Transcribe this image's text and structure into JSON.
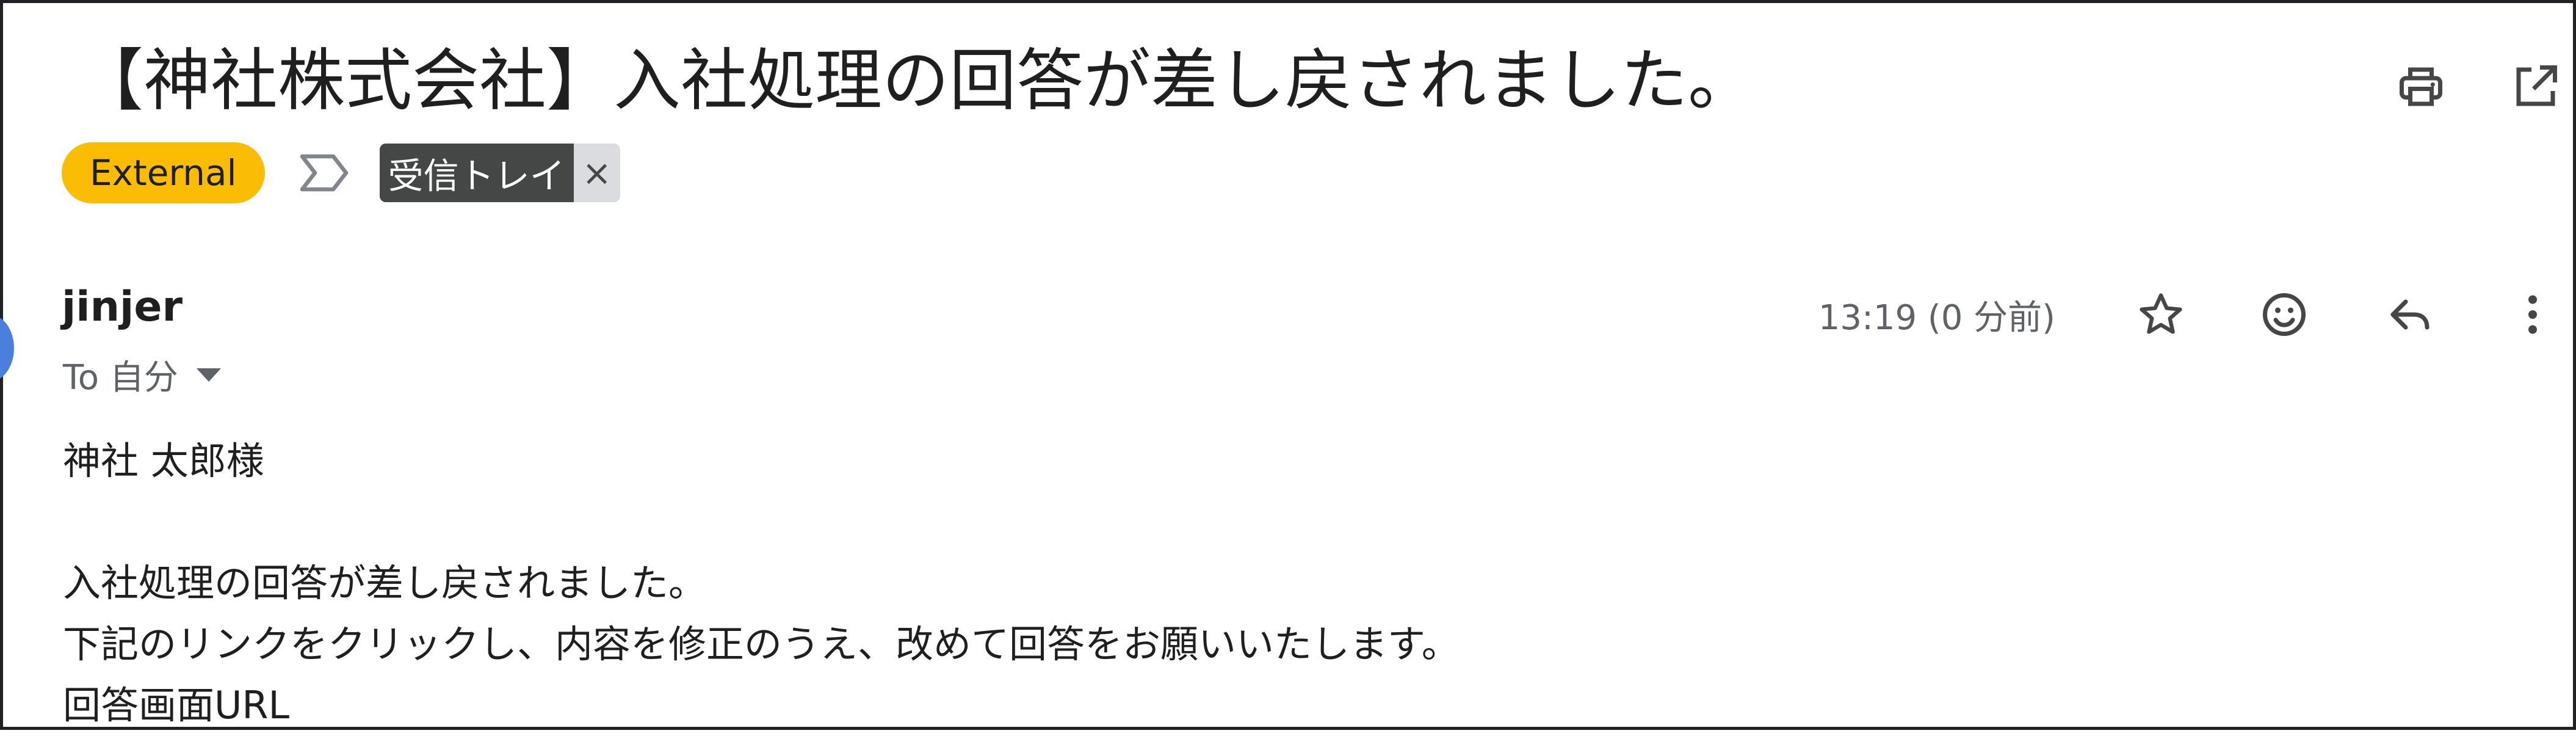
{
  "email": {
    "subject": "【神社株式会社】入社処理の回答が差し戻されました。",
    "labels": {
      "external": "External",
      "inbox": "受信トレイ",
      "remove_symbol": "×"
    },
    "sender": "jinjer",
    "recipient": "To 自分",
    "timestamp": "13:19 (0 分前)",
    "body": {
      "greeting": "神社 太郎様",
      "blank": "",
      "line1": "入社処理の回答が差し戻されました。",
      "line2": "下記のリンクをクリックし、内容を修正のうえ、改めて回答をお願いいたします。",
      "line3": "回答画面URL"
    }
  },
  "icons": {
    "print": "print-icon",
    "open_new_window": "open-in-new-window-icon",
    "importance": "importance-marker-icon",
    "star": "star-icon",
    "emoji": "emoji-reaction-icon",
    "reply": "reply-icon",
    "more": "more-vertical-icon"
  },
  "colors": {
    "external_chip": "#fbbc04",
    "inbox_chip": "#444746",
    "secondary_text": "#5f6368"
  }
}
